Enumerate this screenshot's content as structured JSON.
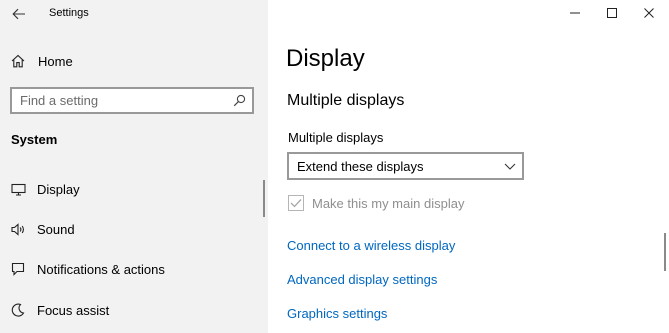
{
  "window": {
    "title": "Settings",
    "controls": {
      "minimize_icon": "minimize-icon",
      "maximize_icon": "maximize-icon",
      "close_icon": "close-icon"
    }
  },
  "sidebar": {
    "home": {
      "label": "Home",
      "icon": "home-icon"
    },
    "search": {
      "placeholder": "Find a setting",
      "value": "",
      "icon": "search-icon"
    },
    "section": "System",
    "items": [
      {
        "label": "Display",
        "icon": "monitor-icon",
        "selected": true
      },
      {
        "label": "Sound",
        "icon": "speaker-icon",
        "selected": false
      },
      {
        "label": "Notifications & actions",
        "icon": "notification-icon",
        "selected": false
      },
      {
        "label": "Focus assist",
        "icon": "moon-icon",
        "selected": false
      }
    ]
  },
  "main": {
    "page_title": "Display",
    "subheading": "Multiple displays",
    "multiple_displays": {
      "label": "Multiple displays",
      "selected": "Extend these displays"
    },
    "main_display_checkbox": {
      "label": "Make this my main display",
      "checked": true,
      "disabled": true
    },
    "links": [
      "Connect to a wireless display",
      "Advanced display settings",
      "Graphics settings"
    ]
  },
  "colors": {
    "sidebar_bg": "#f2f2f2",
    "link": "#0067c0",
    "disabled_text": "#8f8f8f",
    "border": "#999999"
  }
}
